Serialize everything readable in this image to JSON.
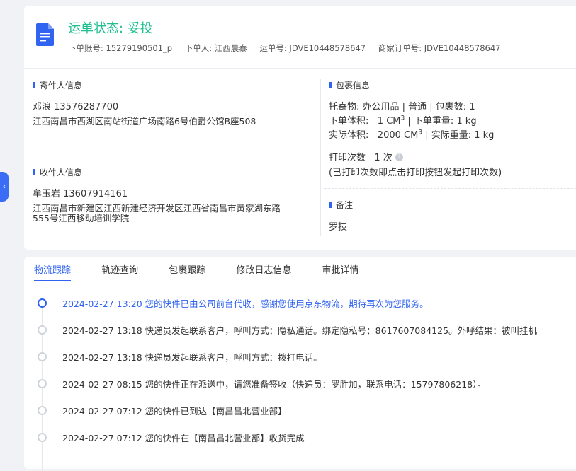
{
  "header": {
    "status_label": "运单状态: 妥投",
    "order_account": "下单账号: 15279190501_p",
    "orderer": "下单人: 江西晨泰",
    "waybill_no": "运单号: JDVE10448578647",
    "merchant_order_no": "商家订单号: JDVE10448578647"
  },
  "sender": {
    "title": "寄件人信息",
    "name_phone": "邓浪   13576287700",
    "address": "江西南昌市西湖区南站街道广场南路6号伯爵公馆B座508"
  },
  "receiver": {
    "title": "收件人信息",
    "name_phone": "牟玉岩   13607914161",
    "address_line1": "江西南昌市新建区江西新建经济开发区江西省南昌市黄家湖东路",
    "address_line2": "555号江西移动培训学院"
  },
  "package": {
    "title": "包裹信息",
    "line1": "托寄物:  办公用品 | 普通 | 包裹数:  1",
    "order_volume_label": "下单体积:",
    "order_volume_value": "1 CM",
    "order_weight": "| 下单重量:  1 kg",
    "actual_volume_label": "实际体积:",
    "actual_volume_value": "2000 CM",
    "actual_weight": "| 实际重量:  1 kg",
    "cube_sup": "3",
    "print_count_label": "打印次数",
    "print_count_value": "1 次",
    "help_glyph": "?",
    "print_note": "(已打印次数即点击打印按钮发起打印次数)"
  },
  "remark": {
    "title": "备注",
    "value": "罗技"
  },
  "tabs": [
    {
      "label": "物流跟踪",
      "active": true
    },
    {
      "label": "轨迹查询",
      "active": false
    },
    {
      "label": "包裹跟踪",
      "active": false
    },
    {
      "label": "修改日志信息",
      "active": false
    },
    {
      "label": "审批详情",
      "active": false
    }
  ],
  "timeline": [
    {
      "time": "2024-02-27 13:20",
      "text": "您的快件已由公司前台代收，感谢您使用京东物流，期待再次为您服务。",
      "active": true
    },
    {
      "time": "2024-02-27 13:18",
      "text": "快递员发起联系客户，呼叫方式：隐私通话。绑定隐私号：8617607084125。外呼结果：被叫挂机",
      "active": false
    },
    {
      "time": "2024-02-27 13:18",
      "text": "快递员发起联系客户，呼叫方式：拨打电话。",
      "active": false
    },
    {
      "time": "2024-02-27 08:15",
      "text": "您的快件正在派送中，请您准备签收（快递员：罗胜加，联系电话：15797806218）。",
      "active": false
    },
    {
      "time": "2024-02-27 07:12",
      "text": "您的快件已到达【南昌昌北营业部】",
      "active": false
    },
    {
      "time": "2024-02-27 07:12",
      "text": "您的快件在【南昌昌北营业部】收货完成",
      "active": false
    }
  ],
  "side_tab_glyph": "‹",
  "colors": {
    "status_green": "#1fbf8f",
    "accent_blue": "#2f63f0"
  }
}
